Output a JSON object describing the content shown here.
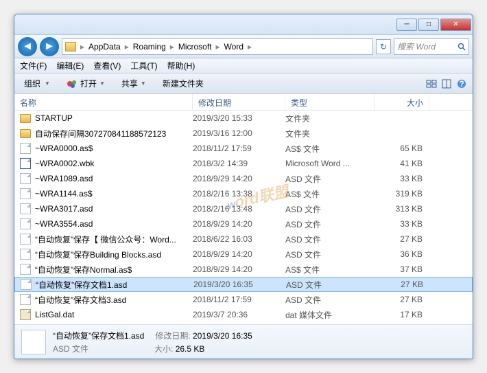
{
  "titlebar": {},
  "breadcrumb": [
    "AppData",
    "Roaming",
    "Microsoft",
    "Word"
  ],
  "search_placeholder": "搜索 Word",
  "menubar": [
    "文件(F)",
    "编辑(E)",
    "查看(V)",
    "工具(T)",
    "帮助(H)"
  ],
  "toolbar": {
    "organize": "组织",
    "open": "打开",
    "share": "共享",
    "newfolder": "新建文件夹"
  },
  "columns": {
    "name": "名称",
    "date": "修改日期",
    "type": "类型",
    "size": "大小"
  },
  "files": [
    {
      "icon": "folder",
      "name": "STARTUP",
      "date": "2019/3/20 15:33",
      "type": "文件夹",
      "size": ""
    },
    {
      "icon": "folder",
      "name": "自动保存间隔307270841188572123",
      "date": "2019/3/16 12:00",
      "type": "文件夹",
      "size": ""
    },
    {
      "icon": "file",
      "name": "~WRA0000.as$",
      "date": "2018/11/2 17:59",
      "type": "AS$ 文件",
      "size": "65 KB"
    },
    {
      "icon": "word",
      "name": "~WRA0002.wbk",
      "date": "2018/3/2 14:39",
      "type": "Microsoft Word ...",
      "size": "41 KB"
    },
    {
      "icon": "file",
      "name": "~WRA1089.asd",
      "date": "2018/9/29 14:20",
      "type": "ASD 文件",
      "size": "33 KB"
    },
    {
      "icon": "file",
      "name": "~WRA1144.as$",
      "date": "2018/2/16 13:38",
      "type": "AS$ 文件",
      "size": "319 KB"
    },
    {
      "icon": "file",
      "name": "~WRA3017.asd",
      "date": "2018/2/16 13:48",
      "type": "ASD 文件",
      "size": "313 KB"
    },
    {
      "icon": "file",
      "name": "~WRA3554.asd",
      "date": "2018/9/29 14:20",
      "type": "ASD 文件",
      "size": "33 KB"
    },
    {
      "icon": "file",
      "name": "“自动恢复”保存【 微信公众号：Word...",
      "date": "2018/6/22 16:03",
      "type": "ASD 文件",
      "size": "27 KB"
    },
    {
      "icon": "file",
      "name": "“自动恢复”保存Building Blocks.asd",
      "date": "2018/9/29 14:20",
      "type": "ASD 文件",
      "size": "36 KB"
    },
    {
      "icon": "file",
      "name": "“自动恢复”保存Normal.as$",
      "date": "2018/9/29 14:20",
      "type": "AS$ 文件",
      "size": "37 KB"
    },
    {
      "icon": "file",
      "name": "“自动恢复”保存文档1.asd",
      "date": "2019/3/20 16:35",
      "type": "ASD 文件",
      "size": "27 KB",
      "selected": true
    },
    {
      "icon": "file",
      "name": "“自动恢复”保存文档3.asd",
      "date": "2018/11/2 17:59",
      "type": "ASD 文件",
      "size": "27 KB"
    },
    {
      "icon": "dat",
      "name": "ListGal.dat",
      "date": "2019/3/7 20:36",
      "type": "dat 媒体文件",
      "size": "17 KB"
    }
  ],
  "details": {
    "name": "“自动恢复”保存文档1.asd",
    "type": "ASD 文件",
    "date_label": "修改日期:",
    "date": "2019/3/20 16:35",
    "size_label": "大小:",
    "size": "26.5 KB"
  }
}
